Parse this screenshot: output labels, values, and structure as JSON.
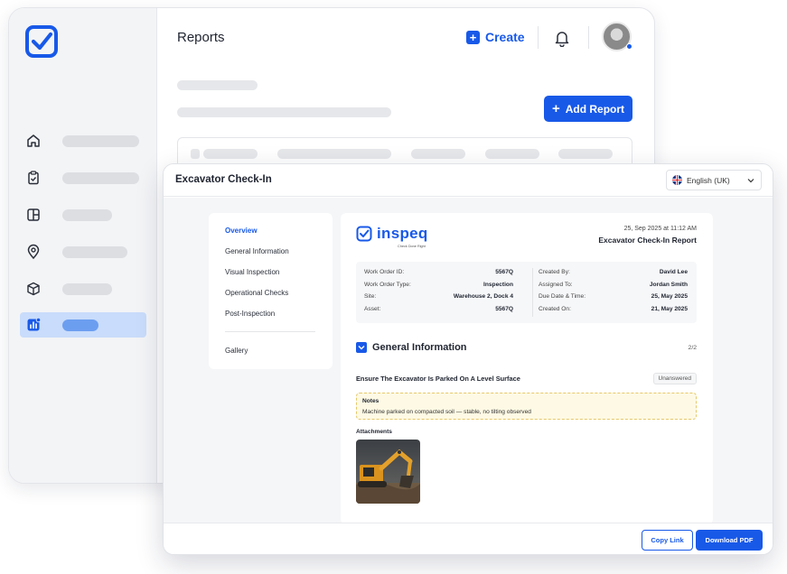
{
  "app": {
    "page_title": "Reports",
    "create_label": "Create",
    "add_report_label": "Add Report",
    "accent_color": "#1859e8",
    "sidebar": {
      "items": [
        {
          "icon": "home-icon",
          "active": false
        },
        {
          "icon": "clipboard-check-icon",
          "active": false
        },
        {
          "icon": "layout-icon",
          "active": false
        },
        {
          "icon": "location-pin-icon",
          "active": false
        },
        {
          "icon": "box-icon",
          "active": false
        },
        {
          "icon": "report-chart-icon",
          "active": true
        }
      ]
    }
  },
  "modal": {
    "title": "Excavator Check-In",
    "language": "English (UK)",
    "toc": [
      "Overview",
      "General Information",
      "Visual Inspection",
      "Operational Checks",
      "Post-Inspection",
      "Gallery"
    ],
    "toc_active": "Overview",
    "report": {
      "brand": "inspeq",
      "brand_tagline": "Check Done Right",
      "date": "25, Sep 2025 at 11:12 AM",
      "title": "Excavator Check-In Report",
      "info_left": [
        {
          "label": "Work Order ID:",
          "value": "5567Q"
        },
        {
          "label": "Work Order Type:",
          "value": "Inspection"
        },
        {
          "label": "Site:",
          "value": "Warehouse 2, Dock 4"
        },
        {
          "label": "Asset:",
          "value": "5567Q"
        }
      ],
      "info_right": [
        {
          "label": "Created By:",
          "value": "David Lee"
        },
        {
          "label": "Assigned To:",
          "value": "Jordan Smith"
        },
        {
          "label": "Due Date & Time:",
          "value": "25, May 2025"
        },
        {
          "label": "Created On:",
          "value": "21, May 2025"
        }
      ],
      "section_title": "General Information",
      "section_count": "2/2",
      "question": "Ensure The Excavator Is Parked On A Level Surface",
      "status_badge": "Unanswered",
      "notes_label": "Notes",
      "notes_text": "Machine parked on compacted soil — stable, no tilting observed",
      "attachments_label": "Attachments"
    },
    "footer": {
      "copy_link_label": "Copy Link",
      "download_pdf_label": "Download PDF"
    }
  }
}
